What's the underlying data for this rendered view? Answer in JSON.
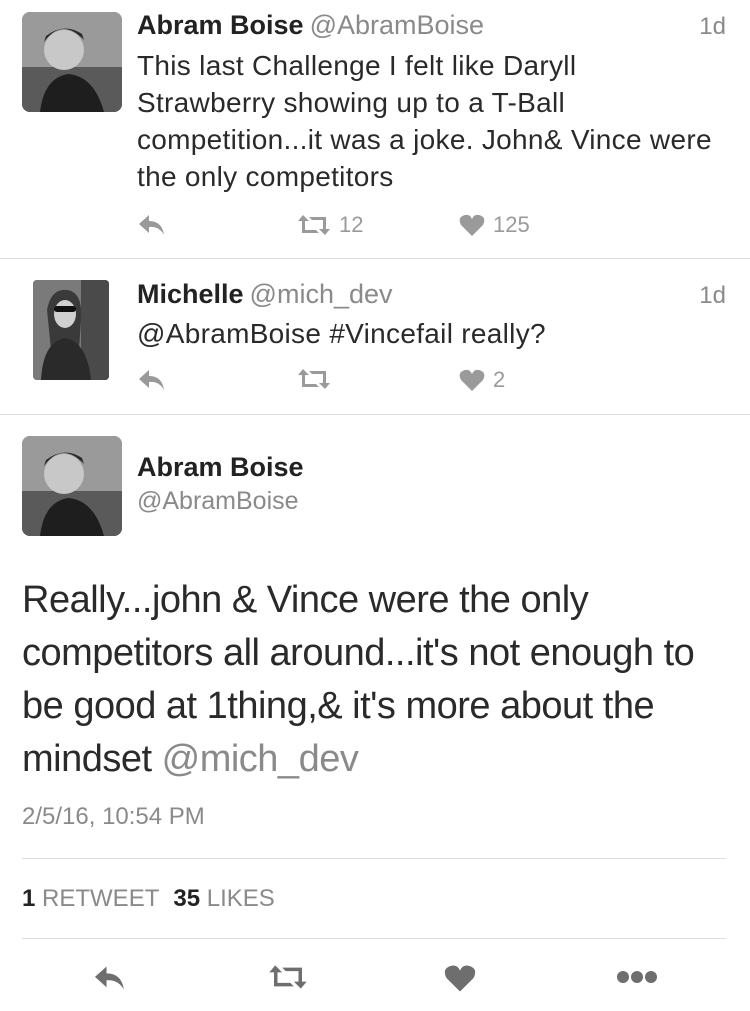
{
  "tweets": [
    {
      "name": "Abram Boise",
      "handle": "@AbramBoise",
      "time": "1d",
      "text": "This last Challenge I felt like Daryll Strawberry showing up to a T-Ball competition...it was a joke. John& Vince were the only competitors",
      "retweets": "12",
      "likes": "125",
      "reply_icon": "reply-icon",
      "retweet_icon": "retweet-icon",
      "like_icon": "heart-icon"
    },
    {
      "name": "Michelle",
      "handle": "@mich_dev",
      "time": "1d",
      "text": "@AbramBoise #Vincefail really?",
      "retweets": "",
      "likes": "2",
      "reply_icon": "reply-icon",
      "retweet_icon": "retweet-icon",
      "like_icon": "heart-icon"
    }
  ],
  "detail": {
    "name": "Abram Boise",
    "handle": "@AbramBoise",
    "text": "Really...john & Vince were the only competitors all around...it's not enough to be good at 1thing,& it's more about the mindset",
    "mention": "@mich_dev",
    "timestamp": "2/5/16, 10:54 PM",
    "retweet_count": "1",
    "retweet_label": "RETWEET",
    "like_count": "35",
    "like_label": "LIKES"
  },
  "colors": {
    "text": "#2a2a2a",
    "muted": "#8a8a8a",
    "divider": "#dcdcdc"
  }
}
